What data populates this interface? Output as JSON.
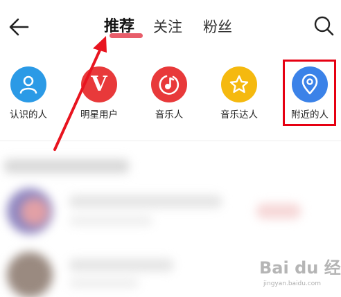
{
  "header": {
    "tabs": [
      {
        "label": "推荐",
        "active": true
      },
      {
        "label": "关注",
        "active": false
      },
      {
        "label": "粉丝",
        "active": false
      }
    ],
    "icons": {
      "back": "back-arrow-icon",
      "search": "search-icon"
    },
    "accent_color": "#e85d6a"
  },
  "categories": [
    {
      "label": "认识的人",
      "icon": "person-icon",
      "color": "#2b9ae6"
    },
    {
      "label": "明星用户",
      "icon": "v-badge-icon",
      "color": "#e8393a"
    },
    {
      "label": "音乐人",
      "icon": "music-note-icon",
      "color": "#e8393a"
    },
    {
      "label": "音乐达人",
      "icon": "star-icon",
      "color": "#f5b90f"
    },
    {
      "label": "附近的人",
      "icon": "location-pin-icon",
      "color": "#3b82e8"
    }
  ],
  "annotation": {
    "highlight_color": "#e60012"
  },
  "watermark": {
    "line1": "Bai du 经验",
    "line2": "jingyan.baidu.com"
  }
}
